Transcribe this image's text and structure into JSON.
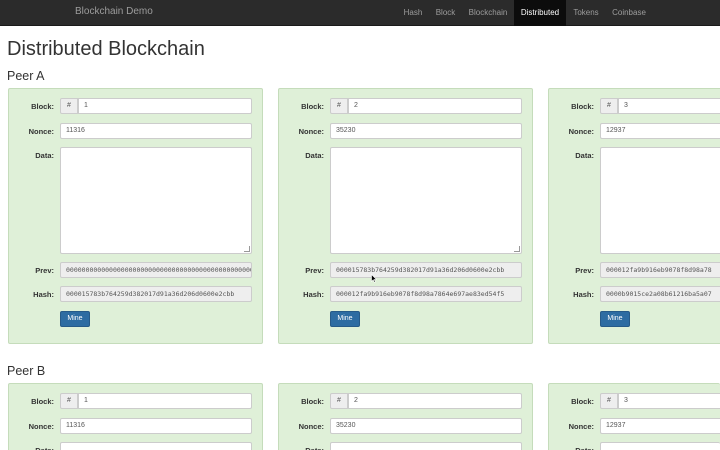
{
  "nav": {
    "brand": "Blockchain Demo",
    "items": [
      "Hash",
      "Block",
      "Blockchain",
      "Distributed",
      "Tokens",
      "Coinbase"
    ],
    "active": "Distributed"
  },
  "page_title": "Distributed Blockchain",
  "labels": {
    "block": "Block:",
    "nonce": "Nonce:",
    "data": "Data:",
    "prev": "Prev:",
    "hash": "Hash:",
    "hash_prefix": "#",
    "mine": "Mine"
  },
  "peers": [
    {
      "name": "Peer A",
      "blocks": [
        {
          "number": "1",
          "nonce": "11316",
          "data": "",
          "prev": "0000000000000000000000000000000000000000000000000000000000000000",
          "hash": "000015783b764259d382017d91a36d206d0600e2cbb"
        },
        {
          "number": "2",
          "nonce": "35230",
          "data": "",
          "prev": "000015783b764259d382017d91a36d206d0600e2cbb",
          "hash": "000012fa9b916eb9078f8d98a7864e697ae83ed54f5"
        },
        {
          "number": "3",
          "nonce": "12937",
          "data": "",
          "prev": "000012fa9b916eb9078f8d98a78",
          "hash": "0000b9015ce2a08b61216ba5a07"
        }
      ]
    },
    {
      "name": "Peer B",
      "blocks": [
        {
          "number": "1",
          "nonce": "11316"
        },
        {
          "number": "2",
          "nonce": "35230"
        },
        {
          "number": "3",
          "nonce": "12937"
        }
      ]
    }
  ]
}
